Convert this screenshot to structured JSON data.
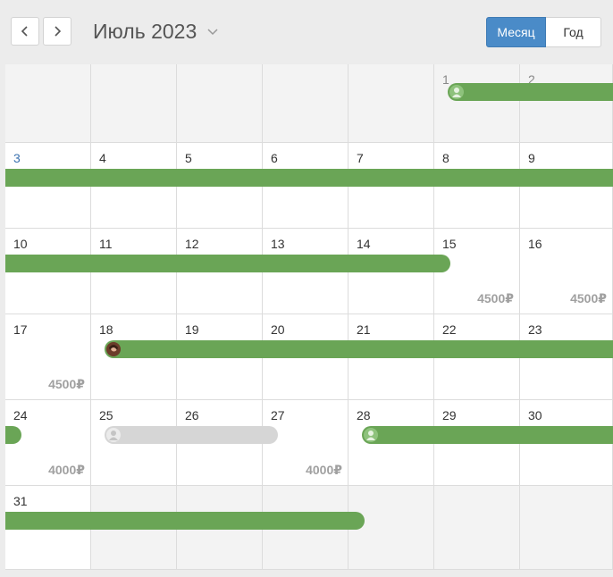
{
  "header": {
    "title": "Июль 2023",
    "views": {
      "month": "Месяц",
      "year": "Год"
    },
    "accent_color": "#4a8bc8"
  },
  "calendar": {
    "weeks": [
      [
        "",
        "",
        "",
        "",
        "",
        "1",
        "2"
      ],
      [
        "3",
        "4",
        "5",
        "6",
        "7",
        "8",
        "9"
      ],
      [
        "10",
        "11",
        "12",
        "13",
        "14",
        "15",
        "16"
      ],
      [
        "17",
        "18",
        "19",
        "20",
        "21",
        "22",
        "23"
      ],
      [
        "24",
        "25",
        "26",
        "27",
        "28",
        "29",
        "30"
      ],
      [
        "31",
        "",
        "",
        "",
        "",
        "",
        ""
      ]
    ],
    "prices": [
      {
        "day": "15",
        "text": "4500₽"
      },
      {
        "day": "16",
        "text": "4500₽"
      },
      {
        "day": "17",
        "text": "4500₽"
      },
      {
        "day": "24",
        "text": "4000₽"
      },
      {
        "day": "27",
        "text": "4000₽"
      }
    ],
    "bookings": [
      {
        "start": "1",
        "end": "2",
        "avatar": "person-icon",
        "status": "booked",
        "color": "#6aa556"
      },
      {
        "start": "3",
        "end": "9",
        "status": "booked",
        "color": "#6aa556"
      },
      {
        "start": "10",
        "end": "15",
        "status": "booked",
        "color": "#6aa556"
      },
      {
        "start": "18",
        "end": "24",
        "avatar": "photo-avatar",
        "status": "booked",
        "color": "#6aa556"
      },
      {
        "start": "25",
        "end": "27",
        "avatar": "person-icon",
        "status": "pending",
        "color": "#d6d6d6"
      },
      {
        "start": "28",
        "end": "30",
        "avatar": "person-icon",
        "status": "booked",
        "color": "#6aa556"
      },
      {
        "start": "31",
        "end": "31",
        "status": "booked",
        "color": "#6aa556"
      }
    ]
  }
}
